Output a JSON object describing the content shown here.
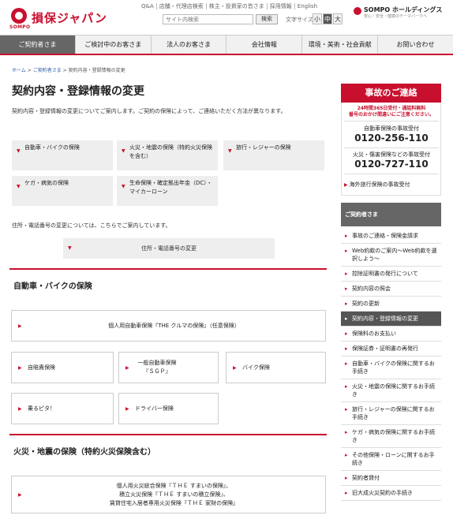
{
  "header": {
    "logo_sub": "SOMPO",
    "logo_text": "損保ジャパン",
    "util_links": [
      "Q&A",
      "店舗・代理店検索",
      "株主・投資家の皆さま",
      "採用情報",
      "English"
    ],
    "search_placeholder": "サイト内検索",
    "search_button": "検索",
    "font_size_label": "文字サイズ",
    "font_sizes": [
      "小",
      "中",
      "大"
    ],
    "holdings_name": "SOMPO ホールディングス",
    "holdings_sub": "安心・安全・健康のテーマパークへ"
  },
  "nav": [
    "ご契約者さま",
    "ご検討中のお客さま",
    "法人のお客さま",
    "会社情報",
    "環境・美術・社会貢献",
    "お問い合わせ"
  ],
  "breadcrumb": {
    "items": [
      "ホーム",
      "ご契約者さま",
      "契約内容・登録情報の変更"
    ],
    "sep": ">"
  },
  "main": {
    "title": "契約内容・登録情報の変更",
    "intro": "契約内容・登録情報の変更についてご案内します。ご契約の保険によって、ご連絡いただく方法が異なります。",
    "categories": [
      "自動車・バイクの保険",
      "火災・地震の保険（特約火災保険を含む）",
      "旅行・レジャーの保険",
      "ケガ・病気の保険",
      "生命保険・確定拠出年金（DC）・マイカーローン"
    ],
    "address_note": "住所・電話番号の変更については、こちらでご案内しています。",
    "address_button": "住所・電話番号の変更",
    "section1_title": "自動車・バイクの保険",
    "section1_cards": [
      "個人用自動車保険『THE クルマの保険』（任意保険）",
      "自賠責保険",
      "一般自動車保険『ＳＧＰ』",
      "バイク保険",
      "乗るピタ！",
      "ドライバー保険"
    ],
    "section2_title": "火災・地震の保険（特約火災保険含む）",
    "section2_card": [
      "個人用火災総合保険『ＴＨＥ すまいの保険』、",
      "積立火災保険『ＴＨＥ すまいの積立保険』、",
      "賃貸住宅入居者専用火災保険『ＴＨＥ 家財の保険』"
    ]
  },
  "side": {
    "accident_title": "事故のご連絡",
    "accident_24h": [
      "24時間365日受付・通話料無料",
      "番号のおかけ間違いにご注意ください。"
    ],
    "auto_label": "自動車保険の事故受付",
    "auto_tel": "0120-256-110",
    "fire_label": "火災・傷害保険などの事故受付",
    "fire_tel": "0120-727-110",
    "overseas": "海外旅行保険の事故受付",
    "menu_head": "ご契約者さま",
    "menu": [
      "事故のご連絡・保険金請求",
      "Web約款のご案内〜Web約款を選択しよう〜",
      "控除証明書の発行について",
      "契約内容の照会",
      "契約の更新",
      "契約内容・登録情報の変更",
      "保険料のお支払い",
      "保険証券・証明書の再発行",
      "自動車・バイクの保険に関するお手続き",
      "火災・地震の保険に関するお手続き",
      "旅行・レジャーの保険に関するお手続き",
      "ケガ・病気の保険に関するお手続き",
      "その他保険・ローンに関するお手続き",
      "契約者貸付",
      "旧大成火災契約の手続き"
    ],
    "active_index": 5
  },
  "colors": {
    "brand": "#c8102e"
  },
  "icons": [
    "triangle-down-icon",
    "triangle-right-icon",
    "triangle-bullet-icon"
  ]
}
